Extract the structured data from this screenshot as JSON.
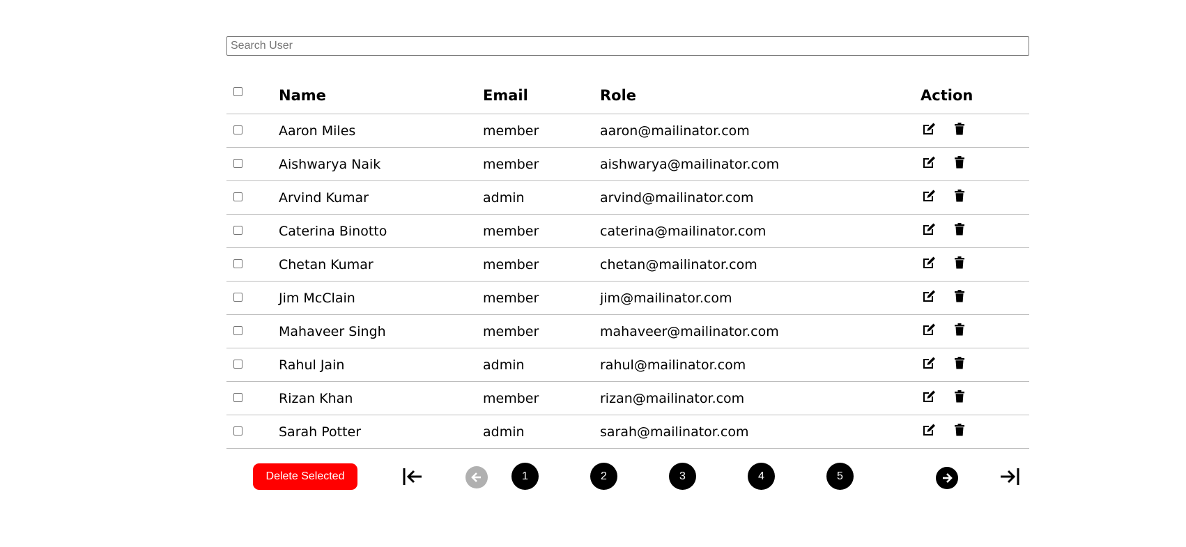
{
  "search": {
    "placeholder": "Search User",
    "value": ""
  },
  "table": {
    "headers": {
      "name": "Name",
      "email": "Email",
      "role": "Role",
      "action": "Action"
    },
    "rows": [
      {
        "name": "Aaron Miles",
        "email": "member",
        "role": "aaron@mailinator.com"
      },
      {
        "name": "Aishwarya Naik",
        "email": "member",
        "role": "aishwarya@mailinator.com"
      },
      {
        "name": "Arvind Kumar",
        "email": "admin",
        "role": "arvind@mailinator.com"
      },
      {
        "name": "Caterina Binotto",
        "email": "member",
        "role": "caterina@mailinator.com"
      },
      {
        "name": "Chetan Kumar",
        "email": "member",
        "role": "chetan@mailinator.com"
      },
      {
        "name": "Jim McClain",
        "email": "member",
        "role": "jim@mailinator.com"
      },
      {
        "name": "Mahaveer Singh",
        "email": "member",
        "role": "mahaveer@mailinator.com"
      },
      {
        "name": "Rahul Jain",
        "email": "admin",
        "role": "rahul@mailinator.com"
      },
      {
        "name": "Rizan Khan",
        "email": "member",
        "role": "rizan@mailinator.com"
      },
      {
        "name": "Sarah Potter",
        "email": "admin",
        "role": "sarah@mailinator.com"
      }
    ],
    "row_icons": [
      "edit-icon",
      "trash-icon"
    ]
  },
  "footer": {
    "delete_selected_label": "Delete Selected",
    "delete_color": "#ff0000",
    "pages": [
      "1",
      "2",
      "3",
      "4",
      "5"
    ],
    "nav_icons": [
      "first-page-icon",
      "previous-page-icon",
      "next-page-icon",
      "last-page-icon"
    ],
    "previous_disabled": true
  }
}
